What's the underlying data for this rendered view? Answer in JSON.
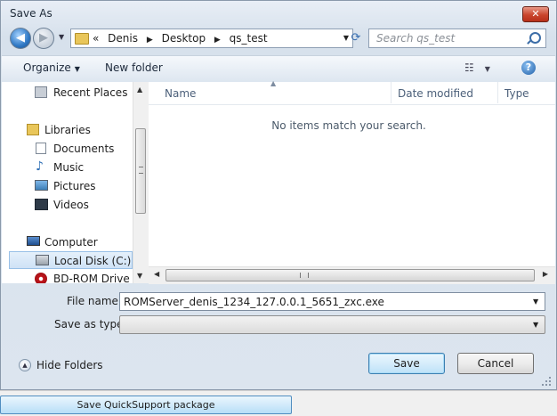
{
  "window": {
    "title": "Save As",
    "close_glyph": "✕"
  },
  "address": {
    "overflow": "«",
    "crumbs": [
      "Denis",
      "Desktop",
      "qs_test"
    ],
    "separator": "▶"
  },
  "search": {
    "placeholder": "Search qs_test"
  },
  "toolbar": {
    "organize": "Organize",
    "new_folder": "New folder"
  },
  "nav_pane": {
    "items": [
      {
        "label": "Recent Places",
        "icon": "recent-places-icon"
      },
      {
        "label": "Libraries",
        "icon": "libraries-icon"
      },
      {
        "label": "Documents",
        "icon": "documents-icon"
      },
      {
        "label": "Music",
        "icon": "music-icon"
      },
      {
        "label": "Pictures",
        "icon": "pictures-icon"
      },
      {
        "label": "Videos",
        "icon": "videos-icon"
      },
      {
        "label": "Computer",
        "icon": "computer-icon"
      },
      {
        "label": "Local Disk (C:)",
        "icon": "local-disk-icon",
        "selected": true
      },
      {
        "label": "BD-ROM Drive (D",
        "icon": "bd-rom-drive-icon"
      }
    ]
  },
  "file_list": {
    "columns": [
      "Name",
      "Date modified",
      "Type"
    ],
    "empty_message": "No items match your search."
  },
  "form": {
    "file_name_label": "File name:",
    "file_name_value": "ROMServer_denis_1234_127.0.0.1_5651_zxc.exe",
    "save_type_label": "Save as type:",
    "save_type_value": ""
  },
  "footer": {
    "hide_folders": "Hide Folders",
    "save": "Save",
    "cancel": "Cancel"
  },
  "taskbar": {
    "button": "Save QuickSupport package"
  },
  "colors": {
    "accent": "#3c7fb1",
    "selection": "#cfe2f6",
    "close_button": "#c9452d"
  }
}
